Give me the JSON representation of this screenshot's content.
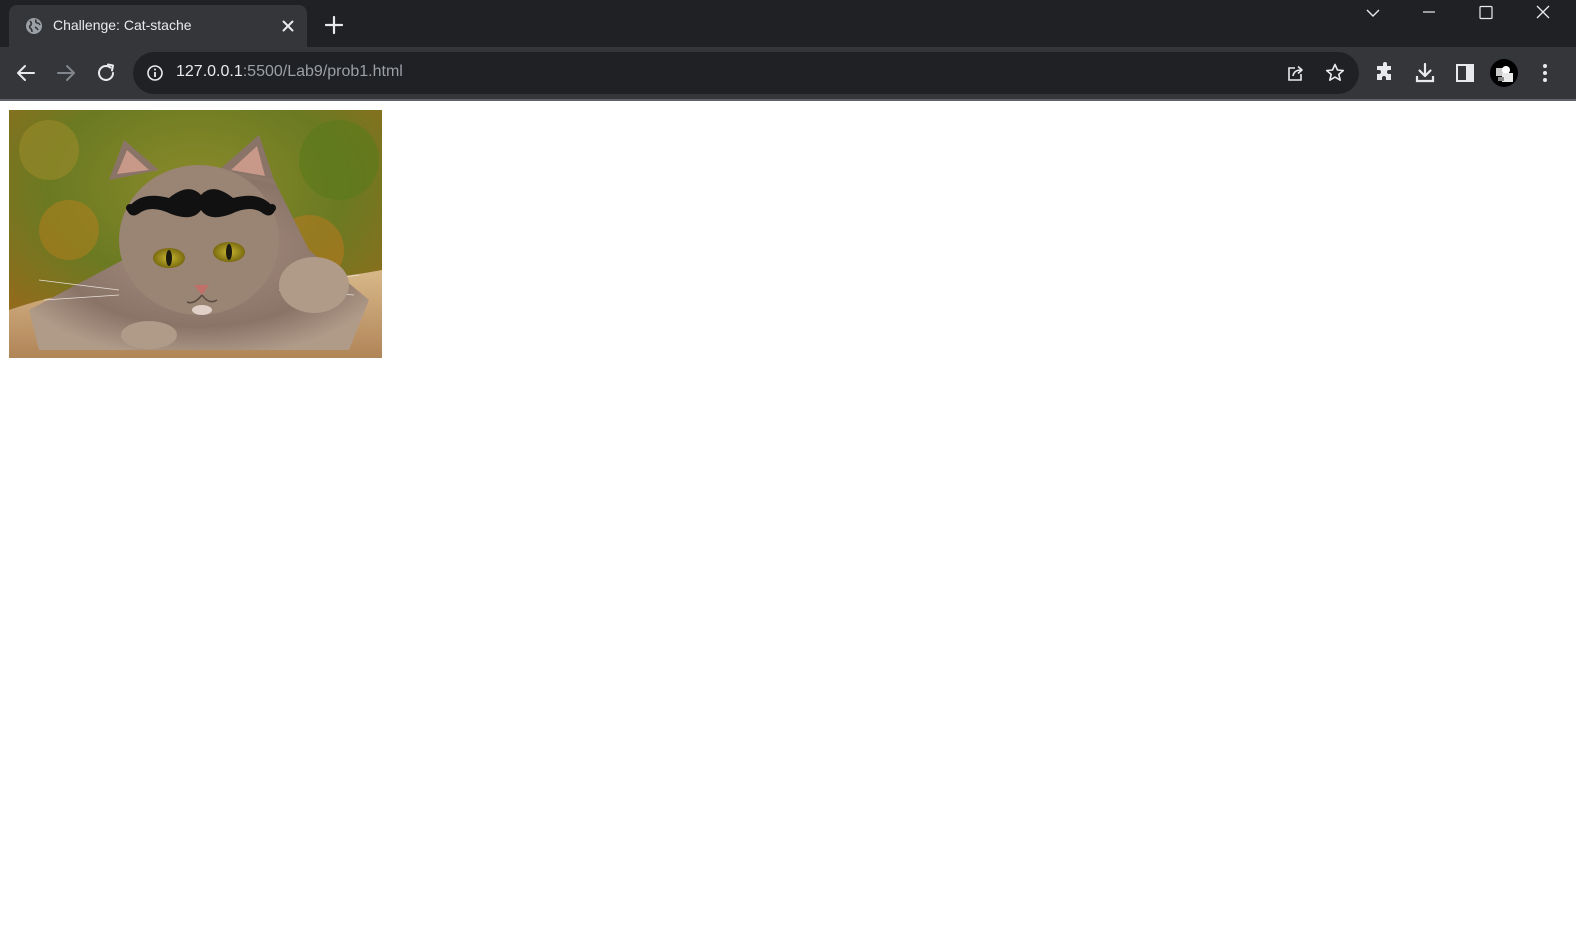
{
  "tab": {
    "title": "Challenge: Cat-stache",
    "favicon": "globe-icon"
  },
  "omnibox": {
    "url_host": "127.0.0.1",
    "url_rest": ":5500/Lab9/prob1.html",
    "security_icon": "info-icon"
  },
  "toolbar": {
    "icons": [
      "back-arrow-icon",
      "forward-arrow-icon",
      "reload-icon",
      "share-icon",
      "star-icon",
      "extensions-icon",
      "download-icon",
      "side-panel-icon",
      "avatar",
      "menu-icon"
    ]
  },
  "window_controls": [
    "tab-search-icon",
    "minimize-icon",
    "maximize-icon",
    "close-icon"
  ],
  "page": {
    "image": "cat-with-mustache"
  },
  "colors": {
    "tabstrip": "#202124",
    "toolbar": "#35363a",
    "omnibox": "#202124",
    "text": "#e8eaed",
    "dim_text": "#9aa0a6"
  }
}
